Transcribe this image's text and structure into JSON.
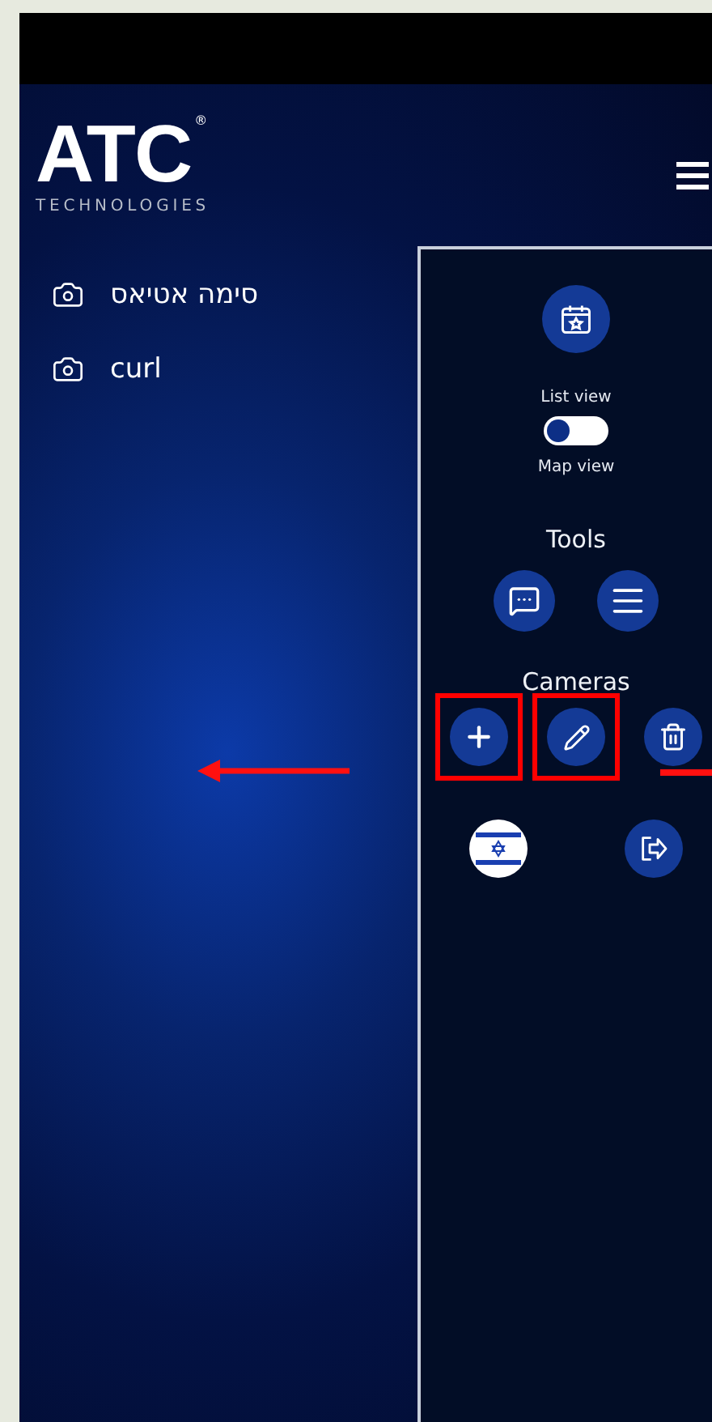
{
  "header": {
    "logo_text": "ATC",
    "logo_mark": "®",
    "logo_subtext": "TECHNOLOGIES"
  },
  "cameras_list": [
    {
      "label": "סימה אטיאס"
    },
    {
      "label": "curl"
    }
  ],
  "panel": {
    "view_toggle": {
      "top_label": "List view",
      "bottom_label": "Map view",
      "on": false
    },
    "tools_title": "Tools",
    "tools": [
      {
        "kind": "chat"
      },
      {
        "kind": "menu"
      }
    ],
    "cameras_title": "Cameras",
    "camera_actions": [
      {
        "kind": "add",
        "highlighted": true
      },
      {
        "kind": "edit",
        "highlighted": true
      },
      {
        "kind": "delete",
        "highlighted": false
      }
    ],
    "footer_actions": [
      {
        "kind": "language"
      },
      {
        "kind": "logout"
      }
    ]
  }
}
